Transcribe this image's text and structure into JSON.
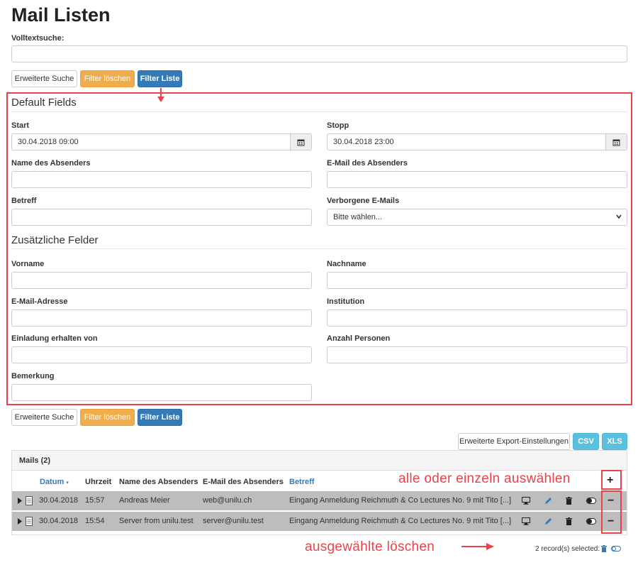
{
  "page": {
    "title": "Mail Listen"
  },
  "search": {
    "label": "Volltextsuche:",
    "value": "",
    "placeholder": ""
  },
  "toolbar": {
    "advanced_search": "Erweiterte Suche",
    "clear_filter": "Filter löschen",
    "filter_list": "Filter Liste"
  },
  "default_fields": {
    "title": "Default Fields",
    "start": {
      "label": "Start",
      "value": "30.04.2018 09:00"
    },
    "stop": {
      "label": "Stopp",
      "value": "30.04.2018 23:00"
    },
    "sender_name": {
      "label": "Name des Absenders",
      "value": ""
    },
    "sender_email": {
      "label": "E-Mail des Absenders",
      "value": ""
    },
    "subject": {
      "label": "Betreff",
      "value": ""
    },
    "hidden_emails": {
      "label": "Verborgene E-Mails",
      "selected": "Bitte wählen..."
    }
  },
  "extra_fields": {
    "title": "Zusätzliche Felder",
    "firstname": {
      "label": "Vorname",
      "value": ""
    },
    "lastname": {
      "label": "Nachname",
      "value": ""
    },
    "email": {
      "label": "E-Mail-Adresse",
      "value": ""
    },
    "institution": {
      "label": "Institution",
      "value": ""
    },
    "invited_by": {
      "label": "Einladung erhalten von",
      "value": ""
    },
    "persons": {
      "label": "Anzahl Personen",
      "value": ""
    },
    "remark": {
      "label": "Bemerkung",
      "value": ""
    }
  },
  "export": {
    "settings": "Erweiterte Export-Einstellungen",
    "csv": "CSV",
    "xls": "XLS"
  },
  "table": {
    "title": "Mails (2)",
    "columns": {
      "date": "Datum",
      "time": "Uhrzeit",
      "sender_name": "Name des Absenders",
      "sender_email": "E-Mail des Absenders",
      "subject": "Betreff"
    },
    "select_all_symbol": "+",
    "rows": [
      {
        "date": "30.04.2018",
        "time": "15:57",
        "sender_name": "Andreas Meier",
        "sender_email": "web@unilu.ch",
        "subject": "Eingang Anmeldung Reichmuth & Co Lectures No. 9 mit Tito [...]",
        "deselect_symbol": "−"
      },
      {
        "date": "30.04.2018",
        "time": "15:54",
        "sender_name": "Server from unilu.test",
        "sender_email": "server@unilu.test",
        "subject": "Eingang Anmeldung Reichmuth & Co Lectures No. 9 mit Tito [...]",
        "deselect_symbol": "−"
      }
    ],
    "selected_text": "2 record(s) selected:"
  },
  "annotations": {
    "select_hint": "alle oder einzeln auswählen",
    "delete_hint": "ausgewählte löschen"
  },
  "colors": {
    "annotation_red": "#e8434b",
    "orange": "#f0ad4e",
    "primary": "#337ab7",
    "info": "#5bc0de",
    "row_selected": "#bdbdbd"
  },
  "icons": {
    "row_expand": "caret-right-icon",
    "row_doc": "document-icon",
    "row_view": "monitor-icon",
    "row_edit": "pencil-icon",
    "row_delete": "trash-icon",
    "row_toggle": "toggle-icon",
    "calendar": "calendar-icon"
  }
}
